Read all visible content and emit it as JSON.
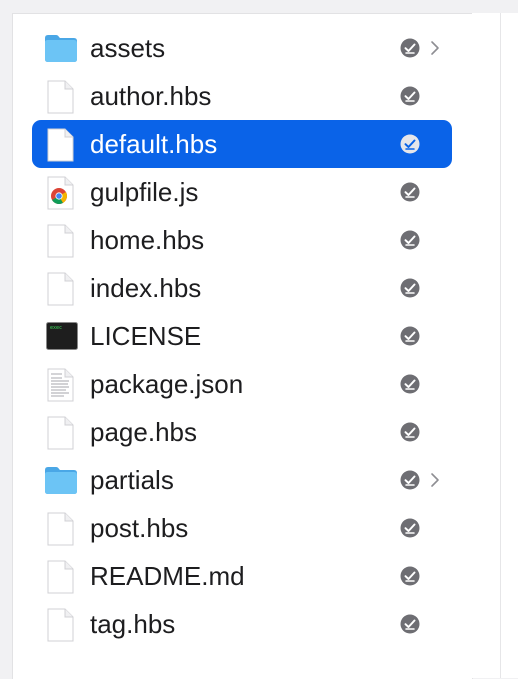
{
  "files": [
    {
      "name": "assets",
      "type": "folder",
      "has_chevron": true,
      "selected": false
    },
    {
      "name": "author.hbs",
      "type": "document",
      "has_chevron": false,
      "selected": false
    },
    {
      "name": "default.hbs",
      "type": "document",
      "has_chevron": false,
      "selected": true
    },
    {
      "name": "gulpfile.js",
      "type": "chrome",
      "has_chevron": false,
      "selected": false
    },
    {
      "name": "home.hbs",
      "type": "document",
      "has_chevron": false,
      "selected": false
    },
    {
      "name": "index.hbs",
      "type": "document",
      "has_chevron": false,
      "selected": false
    },
    {
      "name": "LICENSE",
      "type": "terminal",
      "has_chevron": false,
      "selected": false
    },
    {
      "name": "package.json",
      "type": "text-document",
      "has_chevron": false,
      "selected": false
    },
    {
      "name": "page.hbs",
      "type": "document",
      "has_chevron": false,
      "selected": false
    },
    {
      "name": "partials",
      "type": "folder",
      "has_chevron": true,
      "selected": false
    },
    {
      "name": "post.hbs",
      "type": "document",
      "has_chevron": false,
      "selected": false
    },
    {
      "name": "README.md",
      "type": "document",
      "has_chevron": false,
      "selected": false
    },
    {
      "name": "tag.hbs",
      "type": "document",
      "has_chevron": false,
      "selected": false
    }
  ],
  "icons": {
    "folder": "folder-icon",
    "document": "document-icon",
    "chrome": "chrome-icon",
    "terminal": "terminal-icon",
    "text-document": "text-document-icon",
    "status": "sync-status-icon",
    "chevron": "chevron-right-icon"
  },
  "colors": {
    "selection": "#0a63e8",
    "folder": "#5cb8f0",
    "status_badge": "#6e6e73",
    "text": "#1d1d1f"
  }
}
